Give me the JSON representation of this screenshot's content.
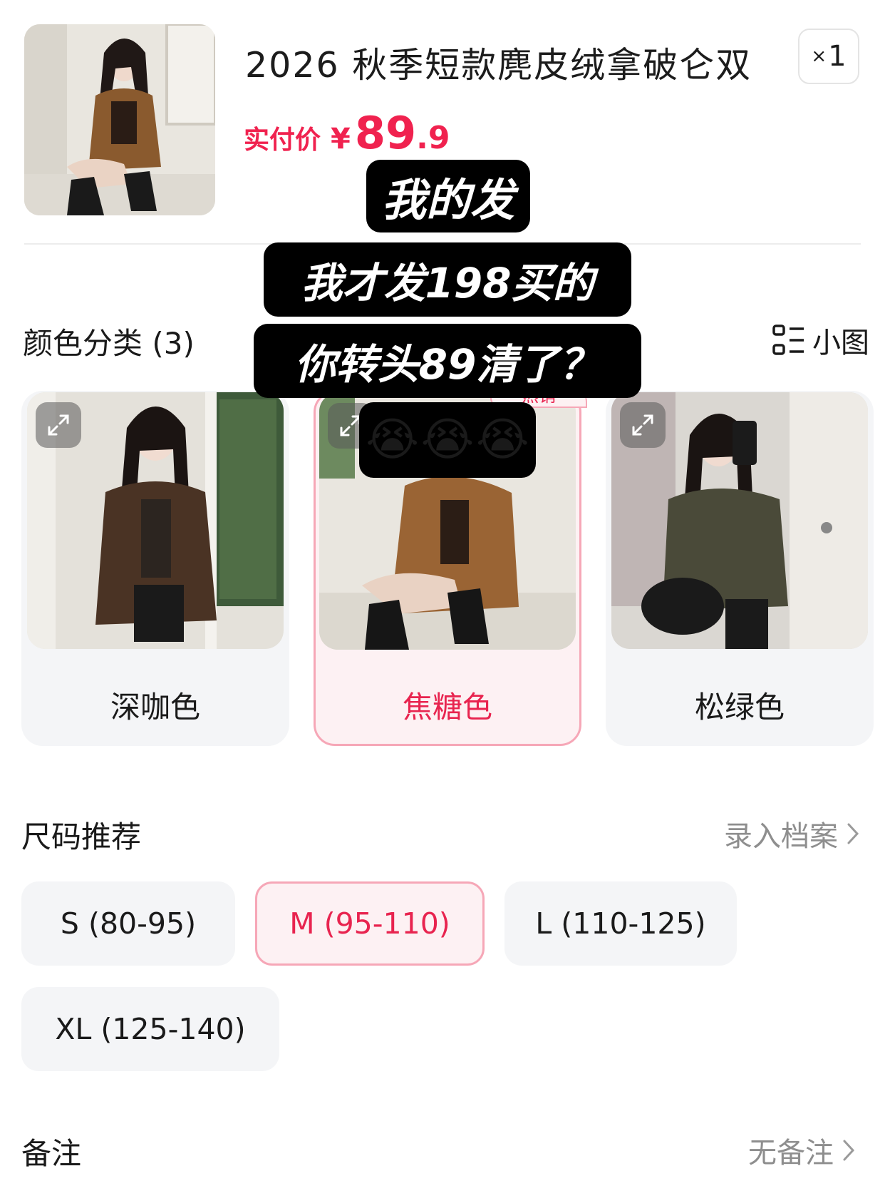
{
  "product": {
    "title": "2026 秋季短款麂皮绒拿破仑双",
    "quantity": "1",
    "quantity_prefix": "×",
    "price_label": "实付价",
    "price_currency": "¥",
    "price_integer": "89",
    "price_decimal": ".9"
  },
  "color_section": {
    "title": "颜色分类 (3)",
    "view_toggle_label": "小图",
    "options": [
      {
        "label": "深咖色",
        "selected": false
      },
      {
        "label": "焦糖色",
        "selected": true
      },
      {
        "label": "松绿色",
        "selected": false
      }
    ],
    "hot_badge": "热销"
  },
  "size_section": {
    "title": "尺码推荐",
    "link_label": "录入档案",
    "options": [
      {
        "label": "S (80-95)",
        "selected": false
      },
      {
        "label": "M (95-110)",
        "selected": true
      },
      {
        "label": "L (110-125)",
        "selected": false
      },
      {
        "label": "XL (125-140)",
        "selected": false
      }
    ]
  },
  "remark_section": {
    "title": "备注",
    "value": "无备注"
  },
  "overlay_caption": {
    "line1": "我的发",
    "line2": "我才发198买的",
    "line3": "你转头89清了？",
    "emojis": [
      "😭",
      "😭",
      "😭"
    ]
  },
  "colors": {
    "accent": "#e8244f",
    "price": "#f0224f",
    "selected_bg": "#fdf1f3",
    "selected_border": "#f6a7b7",
    "option_bg": "#f4f5f7",
    "muted_text": "#8e8e8e"
  }
}
